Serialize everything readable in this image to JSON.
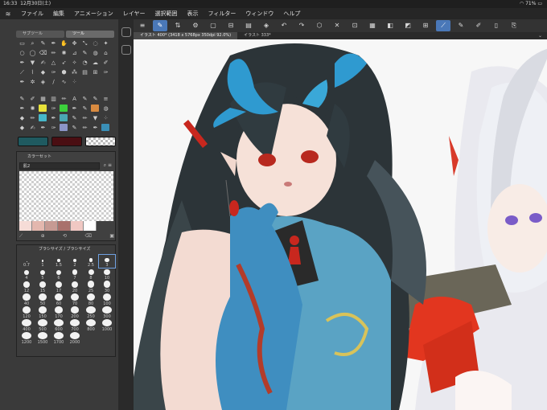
{
  "status": {
    "time": "16:33",
    "date": "12月30日(土)",
    "battery": "71%"
  },
  "menu": [
    "ファイル",
    "編集",
    "アニメーション",
    "レイヤー",
    "選択範囲",
    "表示",
    "フィルター",
    "ウィンドウ",
    "ヘルプ"
  ],
  "tool_tabs": [
    "サブツール",
    "ツール"
  ],
  "colors": {
    "main": "#1f5a60",
    "sub": "#4a0e12",
    "transparent_label": ""
  },
  "color_set": {
    "tab_label": "カラーセット",
    "selected": "肌2",
    "swatches": [
      "#f6dcd7",
      "#e3b7ae",
      "#c69a93",
      "#a9716c",
      "#f0c8c3",
      "#ffffff"
    ]
  },
  "brush_panel": {
    "tab_label": "ブラシサイズ / ブラシサイズ",
    "sizes": [
      "0.7",
      "1",
      "1.5",
      "2",
      "2.5",
      "3",
      "4",
      "5",
      "6",
      "7",
      "8",
      "10",
      "12",
      "15",
      "17",
      "20",
      "25",
      "30",
      "40",
      "50",
      "60",
      "70",
      "80",
      "100",
      "120",
      "150",
      "170",
      "200",
      "250",
      "300",
      "400",
      "500",
      "600",
      "700",
      "800",
      "1000",
      "1200",
      "1500",
      "1700",
      "2000"
    ],
    "selected_index": 5
  },
  "canvas_tabs": [
    {
      "label": "イラスト 400* (3418 x 5768px 350dpi 92.0%)",
      "active": true
    },
    {
      "label": "イラスト 333*",
      "active": false
    }
  ]
}
